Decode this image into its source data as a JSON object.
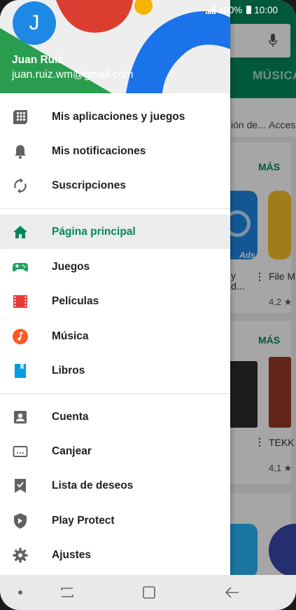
{
  "status": {
    "battery": "100%",
    "time": "10:00"
  },
  "user": {
    "initial": "J",
    "name": "Juan Ruiz",
    "email": "juan.ruiz.wm@gmail.com"
  },
  "menu_groups": [
    [
      {
        "label": "Mis aplicaciones y juegos",
        "icon": "apps-grid-icon"
      },
      {
        "label": "Mis notificaciones",
        "icon": "bell-icon"
      },
      {
        "label": "Suscripciones",
        "icon": "refresh-icon"
      }
    ],
    [
      {
        "label": "Página principal",
        "icon": "home-icon",
        "active": true
      },
      {
        "label": "Juegos",
        "icon": "gamepad-icon"
      },
      {
        "label": "Películas",
        "icon": "film-icon"
      },
      {
        "label": "Música",
        "icon": "music-icon"
      },
      {
        "label": "Libros",
        "icon": "book-icon"
      }
    ],
    [
      {
        "label": "Cuenta",
        "icon": "account-icon"
      },
      {
        "label": "Canjear",
        "icon": "redeem-icon"
      },
      {
        "label": "Lista de deseos",
        "icon": "wishlist-icon"
      },
      {
        "label": "Play Protect",
        "icon": "shield-icon"
      },
      {
        "label": "Ajustes",
        "icon": "gear-icon"
      }
    ]
  ],
  "background": {
    "tab_label": "MÚSICA",
    "categories": [
      "ión de...",
      "Acces"
    ],
    "card1": {
      "more": "MÁS",
      "app1_text": "y\nd...",
      "app1_badge": "Ads",
      "app2_name": "File M",
      "rating": "4,2 ★"
    },
    "card2": {
      "more": "MÁS",
      "app2_name": "TEKK",
      "rating": "4,1 ★"
    }
  },
  "colors": {
    "accent": "#01875f",
    "drawer_bg": "#ffffff",
    "active_bg": "#ececec",
    "avatar": "#1e88e5"
  }
}
